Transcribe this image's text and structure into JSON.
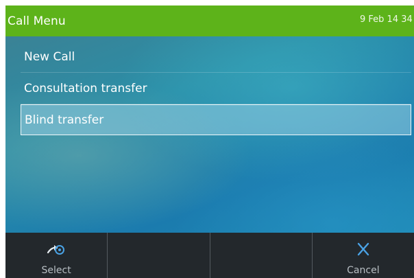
{
  "header": {
    "title": "Call Menu",
    "datetime": "9 Feb 14 34"
  },
  "menu": {
    "items": [
      {
        "label": "New Call"
      },
      {
        "label": "Consultation transfer"
      },
      {
        "label": "Blind transfer"
      }
    ],
    "selected_index": 2
  },
  "softkeys": [
    {
      "label": "Select",
      "icon": "select-arrow-icon"
    },
    {
      "label": ""
    },
    {
      "label": ""
    },
    {
      "label": "Cancel",
      "icon": "close-icon"
    }
  ],
  "colors": {
    "header_bg": "#5db31a",
    "softkey_bar": "#23282c",
    "accent_blue": "#4aa3e6"
  }
}
